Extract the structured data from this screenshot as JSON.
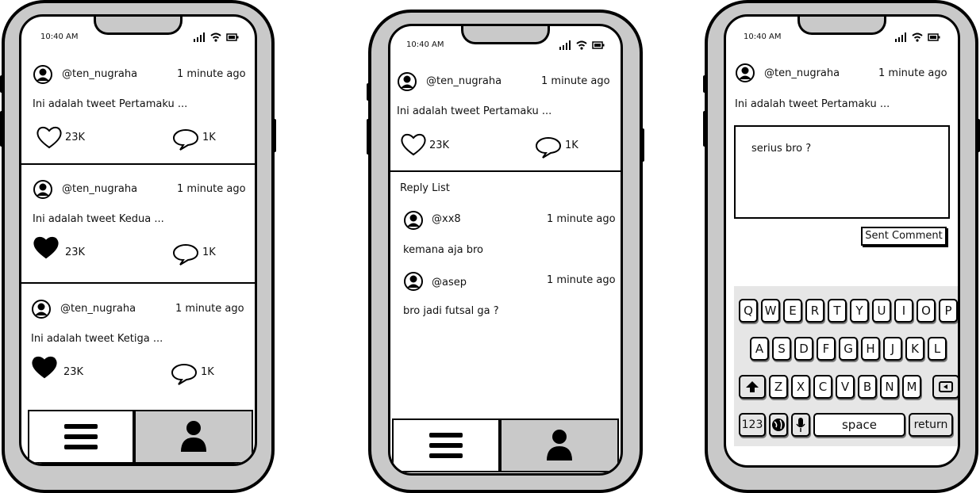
{
  "status": {
    "time": "10:40 AM"
  },
  "phone1": {
    "tweets": [
      {
        "handle": "@ten_nugraha",
        "time": "1 minute ago",
        "text": "Ini adalah tweet Pertamaku ...",
        "likes": "23K",
        "replies": "1K",
        "liked": false
      },
      {
        "handle": "@ten_nugraha",
        "time": "1 minute ago",
        "text": "Ini adalah tweet Kedua ...",
        "likes": "23K",
        "replies": "1K",
        "liked": true
      },
      {
        "handle": "@ten_nugraha",
        "time": "1 minute ago",
        "text": "Ini adalah tweet Ketiga ...",
        "likes": "23K",
        "replies": "1K",
        "liked": true
      }
    ]
  },
  "phone2": {
    "tweet": {
      "handle": "@ten_nugraha",
      "time": "1 minute ago",
      "text": "Ini adalah tweet Pertamaku ...",
      "likes": "23K",
      "replies": "1K"
    },
    "reply_list_label": "Reply List",
    "replies": [
      {
        "handle": "@xx8",
        "time": "1 minute ago",
        "text": "kemana aja bro"
      },
      {
        "handle": "@asep",
        "time": "1 minute ago",
        "text": "bro jadi futsal ga ?"
      }
    ]
  },
  "phone3": {
    "tweet": {
      "handle": "@ten_nugraha",
      "time": "1 minute ago",
      "text": "Ini adalah tweet Pertamaku ..."
    },
    "comment_value": "serius bro ?",
    "sent_button": "Sent Comment",
    "keyboard": {
      "row1": [
        "Q",
        "W",
        "E",
        "R",
        "T",
        "Y",
        "U",
        "I",
        "O",
        "P"
      ],
      "row2": [
        "A",
        "S",
        "D",
        "F",
        "G",
        "H",
        "J",
        "K",
        "L"
      ],
      "row3": [
        "Z",
        "X",
        "C",
        "V",
        "B",
        "N",
        "M"
      ],
      "num_key": "123",
      "space_key": "space",
      "return_key": "return"
    }
  }
}
